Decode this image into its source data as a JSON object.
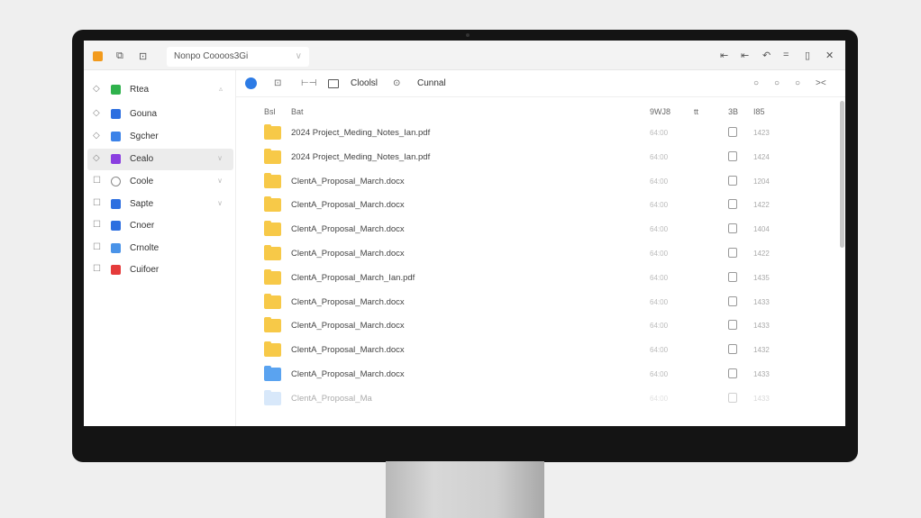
{
  "titlebar": {
    "address": "Nonpo Coooos3Gi",
    "controls": [
      "⇤",
      "⇤",
      "↶",
      "=",
      "▯",
      "✕"
    ]
  },
  "toolbar": {
    "btn1": "Cloolsl",
    "btn2": "Cunnal",
    "right_icons": [
      "search",
      "circle",
      "circle",
      "collapse"
    ]
  },
  "sidebar": {
    "items": [
      {
        "label": "Rtea",
        "color": "#2fb24c",
        "lead": "◇",
        "chev": "▵"
      },
      {
        "label": "Gouna",
        "color": "#2d6fe0",
        "lead": "◇",
        "chev": ""
      },
      {
        "label": "Sgcher",
        "color": "#3b82e8",
        "lead": "◇",
        "chev": ""
      },
      {
        "label": "Cealo",
        "color": "#8a3fe0",
        "lead": "◇",
        "chev": "∨",
        "selected": true
      },
      {
        "label": "Coole",
        "color": "#ffffff",
        "lead": "☐",
        "chev": "∨"
      },
      {
        "label": "Sapte",
        "color": "#2d6fe0",
        "lead": "☐",
        "chev": "∨"
      },
      {
        "label": "Cnoer",
        "color": "#2d6fe0",
        "lead": "☐",
        "chev": ""
      },
      {
        "label": "Crnolte",
        "color": "#4a93e8",
        "lead": "☐",
        "chev": ""
      },
      {
        "label": "Cuifoer",
        "color": "#e53b3b",
        "lead": "☐",
        "chev": ""
      }
    ]
  },
  "list": {
    "headers": [
      "Bsl",
      "Bat",
      "9WJ8",
      "tt",
      "3B",
      "I85"
    ],
    "rows": [
      {
        "name": "2024 Project_Meding_Notes_Ian.pdf",
        "time": "64:00",
        "code": "1423",
        "color": "#f7c948"
      },
      {
        "name": "2024 Project_Meding_Notes_Ian.pdf",
        "time": "64:00",
        "code": "1424",
        "color": "#f7c948"
      },
      {
        "name": "ClentA_Proposal_March.docx",
        "time": "64:00",
        "code": "1204",
        "color": "#f7c948"
      },
      {
        "name": "ClentA_Proposal_March.docx",
        "time": "64:00",
        "code": "1422",
        "color": "#f7c948"
      },
      {
        "name": "ClentA_Proposal_March.docx",
        "time": "64:00",
        "code": "1404",
        "color": "#f7c948"
      },
      {
        "name": "ClentA_Proposal_March.docx",
        "time": "64:00",
        "code": "1422",
        "color": "#f7c948"
      },
      {
        "name": "ClentA_Proposal_March_Ian.pdf",
        "time": "64:00",
        "code": "1435",
        "color": "#f7c948"
      },
      {
        "name": "ClentA_Proposal_March.docx",
        "time": "64:00",
        "code": "1433",
        "color": "#f7c948"
      },
      {
        "name": "ClentA_Proposal_March.docx",
        "time": "64:00",
        "code": "1433",
        "color": "#f7c948"
      },
      {
        "name": "ClentA_Proposal_March.docx",
        "time": "64:00",
        "code": "1432",
        "color": "#f7c948"
      },
      {
        "name": "ClentA_Proposal_March.docx",
        "time": "64:00",
        "code": "1433",
        "color": "#5aa3f0"
      },
      {
        "name": "ClentA_Proposal_Ma",
        "time": "64:00",
        "code": "1433",
        "color": "#a9cdf5"
      }
    ]
  }
}
